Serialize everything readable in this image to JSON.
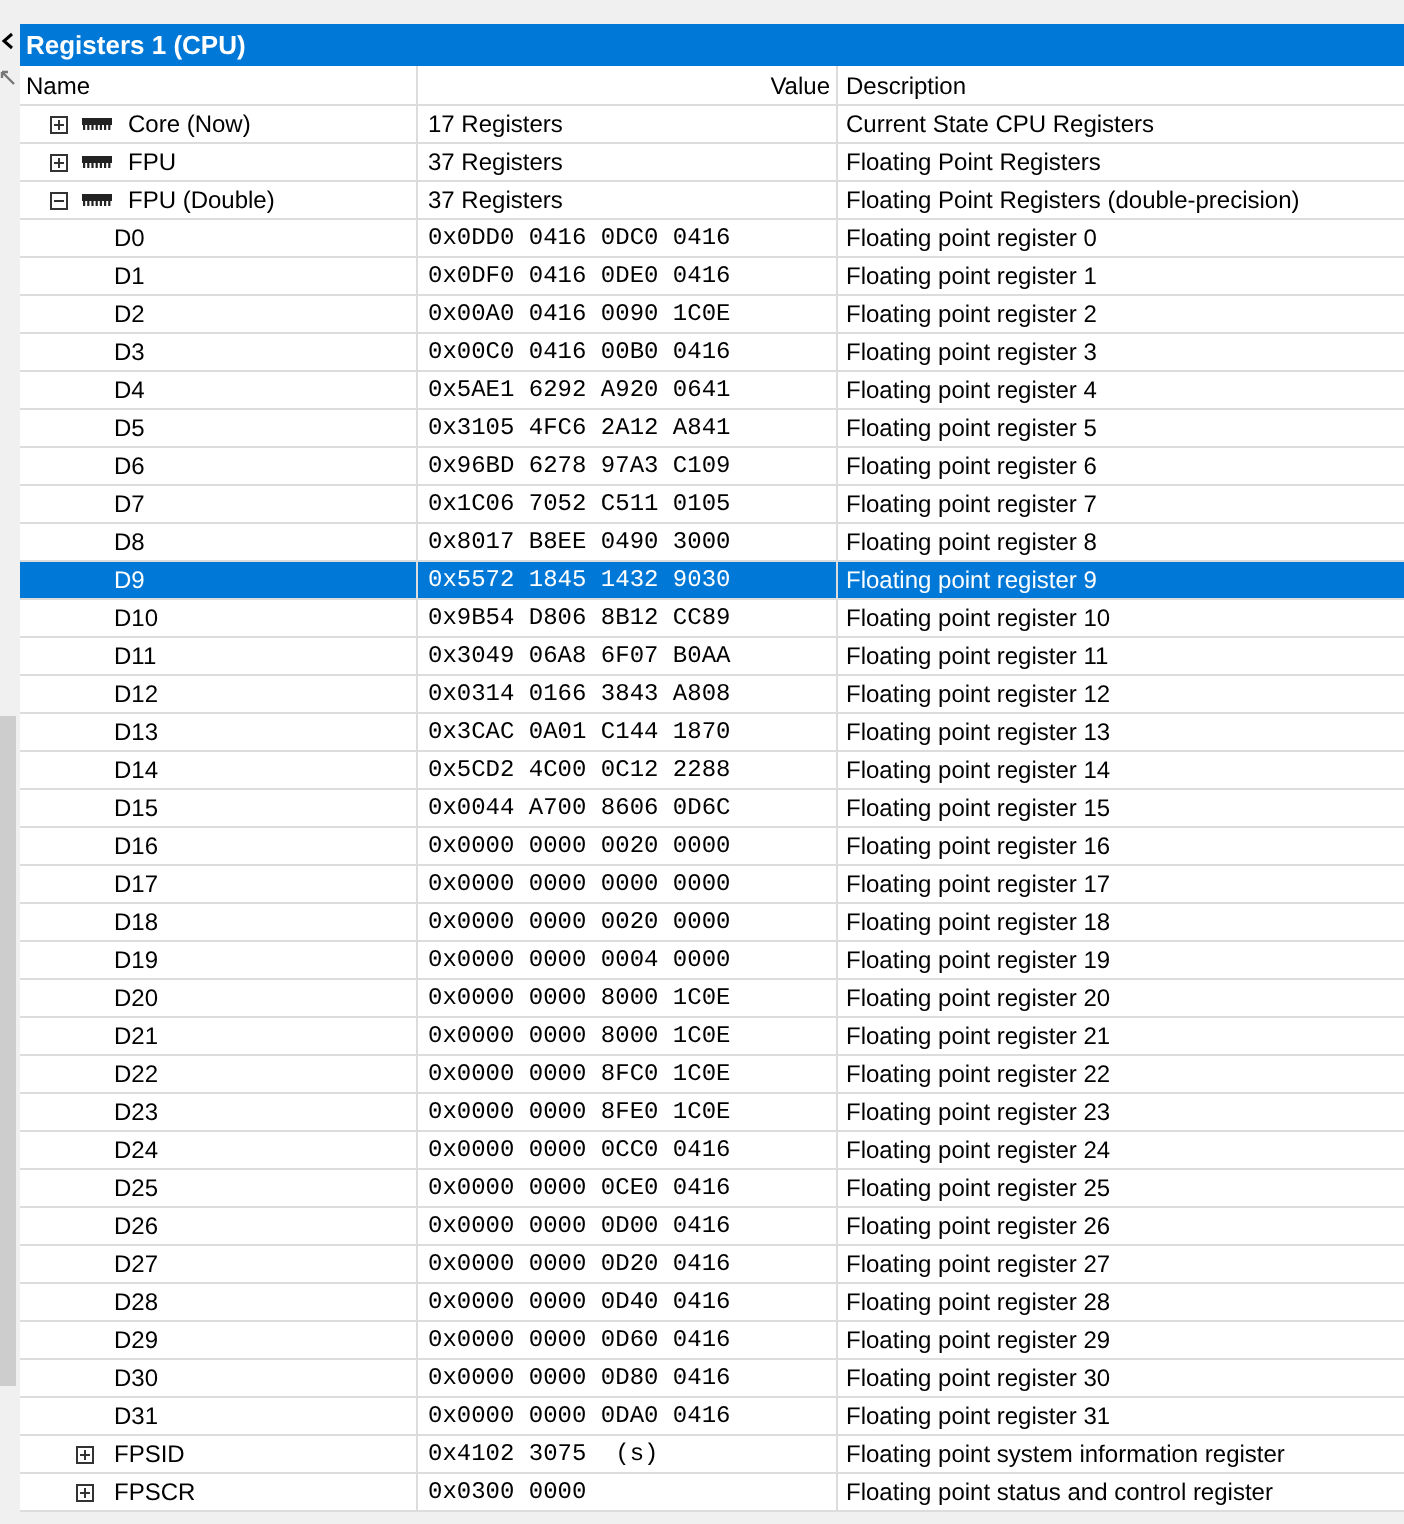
{
  "panel": {
    "title": "Registers 1 (CPU)"
  },
  "columns": [
    {
      "label": "Name"
    },
    {
      "label": "Value"
    },
    {
      "label": "Description"
    }
  ],
  "rows": [
    {
      "kind": "bank",
      "name": "Core (Now)",
      "value": "17 Registers",
      "description": "Current State CPU Registers",
      "expanded": false,
      "selected": false
    },
    {
      "kind": "bank",
      "name": "FPU",
      "value": "37 Registers",
      "description": "Floating Point Registers",
      "expanded": false,
      "selected": false
    },
    {
      "kind": "bank",
      "name": "FPU (Double)",
      "value": "37 Registers",
      "description": "Floating Point Registers (double-precision)",
      "expanded": true,
      "selected": false,
      "children": [
        {
          "kind": "register",
          "name": "D0",
          "value": "0x0DD0 0416 0DC0 0416",
          "description": "Floating point register 0",
          "selected": false
        },
        {
          "kind": "register",
          "name": "D1",
          "value": "0x0DF0 0416 0DE0 0416",
          "description": "Floating point register 1",
          "selected": false
        },
        {
          "kind": "register",
          "name": "D2",
          "value": "0x00A0 0416 0090 1C0E",
          "description": "Floating point register 2",
          "selected": false
        },
        {
          "kind": "register",
          "name": "D3",
          "value": "0x00C0 0416 00B0 0416",
          "description": "Floating point register 3",
          "selected": false
        },
        {
          "kind": "register",
          "name": "D4",
          "value": "0x5AE1 6292 A920 0641",
          "description": "Floating point register 4",
          "selected": false
        },
        {
          "kind": "register",
          "name": "D5",
          "value": "0x3105 4FC6 2A12 A841",
          "description": "Floating point register 5",
          "selected": false
        },
        {
          "kind": "register",
          "name": "D6",
          "value": "0x96BD 6278 97A3 C109",
          "description": "Floating point register 6",
          "selected": false
        },
        {
          "kind": "register",
          "name": "D7",
          "value": "0x1C06 7052 C511 0105",
          "description": "Floating point register 7",
          "selected": false
        },
        {
          "kind": "register",
          "name": "D8",
          "value": "0x8017 B8EE 0490 3000",
          "description": "Floating point register 8",
          "selected": false
        },
        {
          "kind": "register",
          "name": "D9",
          "value": "0x5572 1845 1432 9030",
          "description": "Floating point register 9",
          "selected": true
        },
        {
          "kind": "register",
          "name": "D10",
          "value": "0x9B54 D806 8B12 CC89",
          "description": "Floating point register 10",
          "selected": false
        },
        {
          "kind": "register",
          "name": "D11",
          "value": "0x3049 06A8 6F07 B0AA",
          "description": "Floating point register 11",
          "selected": false
        },
        {
          "kind": "register",
          "name": "D12",
          "value": "0x0314 0166 3843 A808",
          "description": "Floating point register 12",
          "selected": false
        },
        {
          "kind": "register",
          "name": "D13",
          "value": "0x3CAC 0A01 C144 1870",
          "description": "Floating point register 13",
          "selected": false
        },
        {
          "kind": "register",
          "name": "D14",
          "value": "0x5CD2 4C00 0C12 2288",
          "description": "Floating point register 14",
          "selected": false
        },
        {
          "kind": "register",
          "name": "D15",
          "value": "0x0044 A700 8606 0D6C",
          "description": "Floating point register 15",
          "selected": false
        },
        {
          "kind": "register",
          "name": "D16",
          "value": "0x0000 0000 0020 0000",
          "description": "Floating point register 16",
          "selected": false
        },
        {
          "kind": "register",
          "name": "D17",
          "value": "0x0000 0000 0000 0000",
          "description": "Floating point register 17",
          "selected": false
        },
        {
          "kind": "register",
          "name": "D18",
          "value": "0x0000 0000 0020 0000",
          "description": "Floating point register 18",
          "selected": false
        },
        {
          "kind": "register",
          "name": "D19",
          "value": "0x0000 0000 0004 0000",
          "description": "Floating point register 19",
          "selected": false
        },
        {
          "kind": "register",
          "name": "D20",
          "value": "0x0000 0000 8000 1C0E",
          "description": "Floating point register 20",
          "selected": false
        },
        {
          "kind": "register",
          "name": "D21",
          "value": "0x0000 0000 8000 1C0E",
          "description": "Floating point register 21",
          "selected": false
        },
        {
          "kind": "register",
          "name": "D22",
          "value": "0x0000 0000 8FC0 1C0E",
          "description": "Floating point register 22",
          "selected": false
        },
        {
          "kind": "register",
          "name": "D23",
          "value": "0x0000 0000 8FE0 1C0E",
          "description": "Floating point register 23",
          "selected": false
        },
        {
          "kind": "register",
          "name": "D24",
          "value": "0x0000 0000 0CC0 0416",
          "description": "Floating point register 24",
          "selected": false
        },
        {
          "kind": "register",
          "name": "D25",
          "value": "0x0000 0000 0CE0 0416",
          "description": "Floating point register 25",
          "selected": false
        },
        {
          "kind": "register",
          "name": "D26",
          "value": "0x0000 0000 0D00 0416",
          "description": "Floating point register 26",
          "selected": false
        },
        {
          "kind": "register",
          "name": "D27",
          "value": "0x0000 0000 0D20 0416",
          "description": "Floating point register 27",
          "selected": false
        },
        {
          "kind": "register",
          "name": "D28",
          "value": "0x0000 0000 0D40 0416",
          "description": "Floating point register 28",
          "selected": false
        },
        {
          "kind": "register",
          "name": "D29",
          "value": "0x0000 0000 0D60 0416",
          "description": "Floating point register 29",
          "selected": false
        },
        {
          "kind": "register",
          "name": "D30",
          "value": "0x0000 0000 0D80 0416",
          "description": "Floating point register 30",
          "selected": false
        },
        {
          "kind": "register",
          "name": "D31",
          "value": "0x0000 0000 0DA0 0416",
          "description": "Floating point register 31",
          "selected": false
        },
        {
          "kind": "register",
          "name": "FPSID",
          "value": "0x4102 3075  (s)",
          "description": "Floating point system information register",
          "expanded": false,
          "selected": false
        },
        {
          "kind": "register",
          "name": "FPSCR",
          "value": "0x0300 0000",
          "description": "Floating point status and control register",
          "expanded": false,
          "selected": false
        }
      ]
    }
  ]
}
